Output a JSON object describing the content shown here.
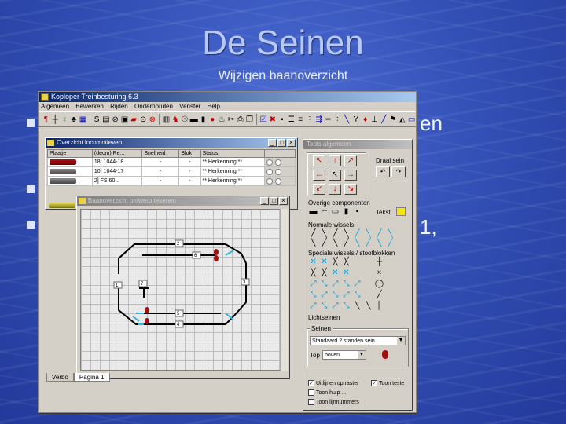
{
  "slide": {
    "title": "De Seinen",
    "subtitle": "Wijzigen baanoverzicht",
    "bullet1_tail": "en",
    "bullet3_tail": "1,"
  },
  "app": {
    "title": "Koploper Treinbesturing 6.3",
    "menu": [
      "Algemeen",
      "Bewerken",
      "Rijden",
      "Onderhouden",
      "Venster",
      "Help"
    ]
  },
  "loco_window": {
    "title": "Overzicht locomotieven",
    "columns": [
      "Plaatje",
      "(decm) Re...",
      "Snelheid",
      "Blok",
      "Status"
    ],
    "rows": [
      {
        "id": "18] 1044-18",
        "speed": "-",
        "block": "-",
        "status": "** Herkenning **"
      },
      {
        "id": "10] 1044-17",
        "speed": "-",
        "block": "-",
        "status": "** Herkenning **"
      },
      {
        "id": "2] FS 60...",
        "speed": "-",
        "block": "-",
        "status": "** Herkenning **"
      }
    ]
  },
  "editor_window": {
    "title": "Baanoverzicht ontwerp tekenen",
    "blocks": [
      "2",
      "6",
      "3",
      "1",
      "7",
      "5",
      "4"
    ],
    "tabs": [
      "Verbo",
      "Pagina 1"
    ]
  },
  "tools_window": {
    "title": "Tools algemeen",
    "rotate_label": "Draai sein",
    "other_components_label": "Overige componenten",
    "text_label": "Tekst",
    "normal_switches_label": "Normale wissels",
    "special_switches_label": "Speciale wissels / stootblokken",
    "signals_label": "Lichtseinen",
    "signal_group_label": "Seinen",
    "signal_type_value": "Standaard 2 standen sein",
    "top_label": "Top",
    "top_value": "boven",
    "checkbox1": "Uitlijnen op raster",
    "checkbox2": "Toon hulp ...",
    "checkbox3": "Toon lijnnummers",
    "checkbox4": "Toon teste"
  },
  "colors": {
    "titlebar": "#0a246a",
    "window": "#d4d0c8",
    "track_highlight": "#34b5d8",
    "signal_red": "#a01010"
  }
}
